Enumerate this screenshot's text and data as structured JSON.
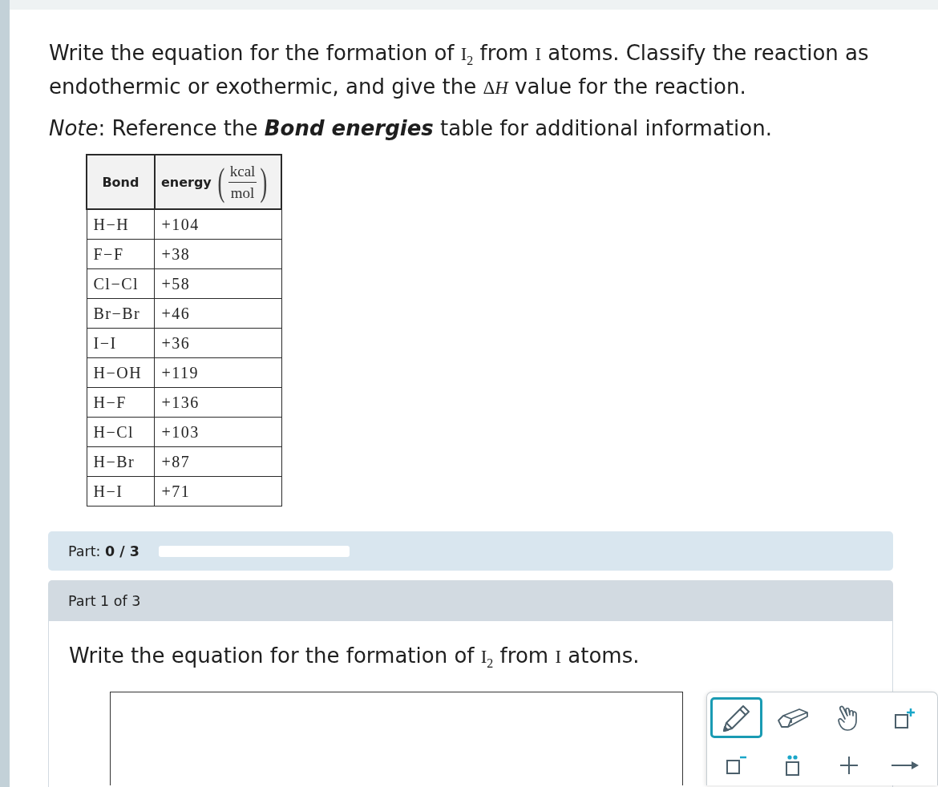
{
  "question": {
    "prompt": [
      {
        "kind": "text",
        "text": "Write the equation for the formation of "
      },
      {
        "kind": "math",
        "text": "I$_{2}$"
      },
      {
        "kind": "text",
        "text": " from "
      },
      {
        "kind": "math",
        "text": "I"
      },
      {
        "kind": "text",
        "text": " atoms. Classify the reaction as endothermic or exothermic, and give the "
      },
      {
        "kind": "math",
        "text": "Δ"
      },
      {
        "kind": "math-italic",
        "text": "H"
      },
      {
        "kind": "text",
        "text": " value for the reaction."
      }
    ],
    "note": [
      {
        "kind": "italic",
        "text": "Note"
      },
      {
        "kind": "text",
        "text": ": Reference the "
      },
      {
        "kind": "bold-italic",
        "text": "Bond energies"
      },
      {
        "kind": "text",
        "text": " table for additional information."
      }
    ]
  },
  "bond_table": {
    "columns": [
      {
        "label": "Bond"
      },
      {
        "label": "energy",
        "unit": {
          "open": "(",
          "numerator": "kcal",
          "denominator": "mol",
          "close": ")"
        }
      }
    ],
    "rows": [
      {
        "bond": "H−H",
        "energy": "+104"
      },
      {
        "bond": "F−F",
        "energy": "+38"
      },
      {
        "bond": "Cl−Cl",
        "energy": "+58"
      },
      {
        "bond": "Br−Br",
        "energy": "+46"
      },
      {
        "bond": "I−I",
        "energy": "+36"
      },
      {
        "bond": "H−OH",
        "energy": "+119"
      },
      {
        "bond": "H−F",
        "energy": "+136"
      },
      {
        "bond": "H−Cl",
        "energy": "+103"
      },
      {
        "bond": "H−Br",
        "energy": "+87"
      },
      {
        "bond": "H−I",
        "energy": "+71"
      }
    ]
  },
  "progress": {
    "label": "Part: **0 / 3**",
    "level": 0
  },
  "part": {
    "title": "Part 1 of 3",
    "prompt": [
      {
        "kind": "text",
        "text": "Write the equation for the formation of "
      },
      {
        "kind": "math",
        "text": "I$_{2}$"
      },
      {
        "kind": "text",
        "text": " from "
      },
      {
        "kind": "math",
        "text": "I"
      },
      {
        "kind": "text",
        "text": " atoms."
      }
    ],
    "answer": {
      "tools": [
        {
          "kind": "pencil",
          "selected": true
        },
        {
          "kind": "eraser",
          "selected": false
        },
        {
          "kind": "hand",
          "selected": false
        },
        {
          "kind": "add-charge",
          "selected": false
        },
        {
          "kind": "remove-charge",
          "selected": false
        },
        {
          "kind": "lone-pair",
          "selected": false
        },
        {
          "kind": "plus",
          "selected": false
        },
        {
          "kind": "arrow",
          "selected": false
        }
      ]
    }
  }
}
